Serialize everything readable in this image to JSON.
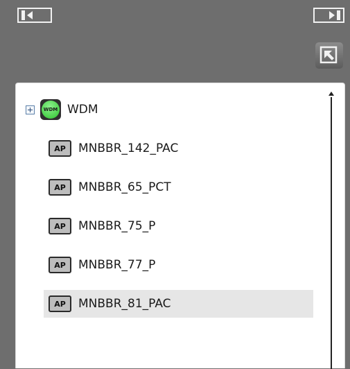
{
  "toolbar": {
    "collapse_left_icon": "panel-collapse-left-icon",
    "expand_right_icon": "panel-expand-right-icon",
    "popout_icon": "popout-arrow-icon"
  },
  "tree": {
    "root": {
      "label": "WDM",
      "icon_text": "WDM",
      "icon": "wdm-network-icon",
      "expanded": false
    },
    "items": [
      {
        "icon_text": "AP",
        "label": "MNBBR_142_PAC"
      },
      {
        "icon_text": "AP",
        "label": "MNBBR_65_PCT"
      },
      {
        "icon_text": "AP",
        "label": "MNBBR_75_P"
      },
      {
        "icon_text": "AP",
        "label": "MNBBR_77_P"
      },
      {
        "icon_text": "AP",
        "label": "MNBBR_81_PAC",
        "selected": true
      }
    ]
  },
  "colors": {
    "background": "#6e6e6e",
    "panel": "#ffffff",
    "selected_row": "#e6e6e6",
    "wdm_green": "#2cc42c"
  }
}
